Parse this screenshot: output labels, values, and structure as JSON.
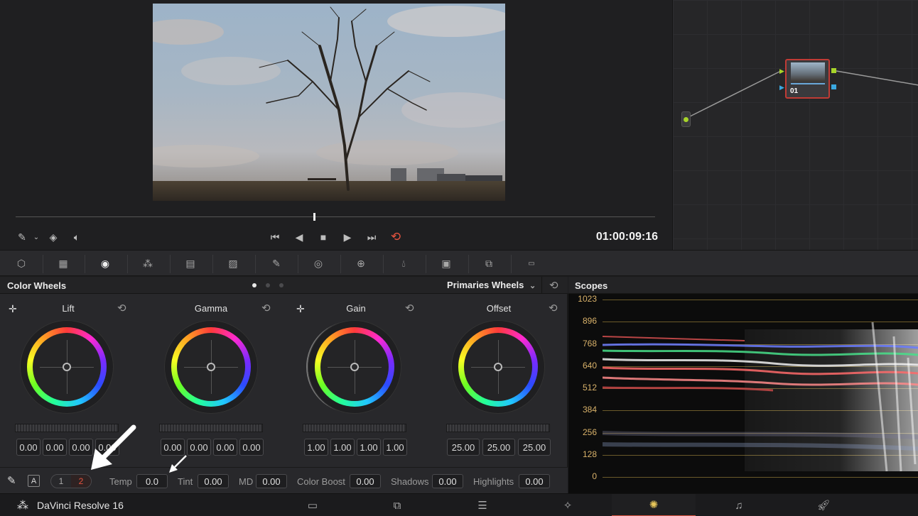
{
  "viewer": {
    "timecode": "01:00:09:16",
    "playhead_fraction": 0.467
  },
  "nodes": {
    "node_label": "01"
  },
  "color_wheels": {
    "title": "Color Wheels",
    "mode_dropdown": "Primaries Wheels",
    "wheels": [
      {
        "label": "Lift",
        "values": [
          "0.00",
          "0.00",
          "0.00",
          "0.00"
        ]
      },
      {
        "label": "Gamma",
        "values": [
          "0.00",
          "0.00",
          "0.00",
          "0.00"
        ]
      },
      {
        "label": "Gain",
        "values": [
          "1.00",
          "1.00",
          "1.00",
          "1.00"
        ]
      },
      {
        "label": "Offset",
        "values": [
          "25.00",
          "25.00",
          "25.00"
        ]
      }
    ],
    "footer": {
      "auto_label": "A",
      "page_1": "1",
      "page_2": "2",
      "temp_label": "Temp",
      "temp_value": "0.0",
      "tint_label": "Tint",
      "tint_value": "0.00",
      "md_label": "MD",
      "md_value": "0.00",
      "color_boost_label": "Color Boost",
      "color_boost_value": "0.00",
      "shadows_label": "Shadows",
      "shadows_value": "0.00",
      "highlights_label": "Highlights",
      "highlights_value": "0.00"
    }
  },
  "scopes": {
    "title": "Scopes",
    "ticks": [
      "1023",
      "896",
      "768",
      "640",
      "512",
      "384",
      "256",
      "128",
      "0"
    ]
  },
  "bottom_bar": {
    "app_name": "DaVinci Resolve 16"
  },
  "colors": {
    "accent": "#d9533f",
    "node_border": "#c03b35",
    "scope_grid": "#d9b26a"
  }
}
